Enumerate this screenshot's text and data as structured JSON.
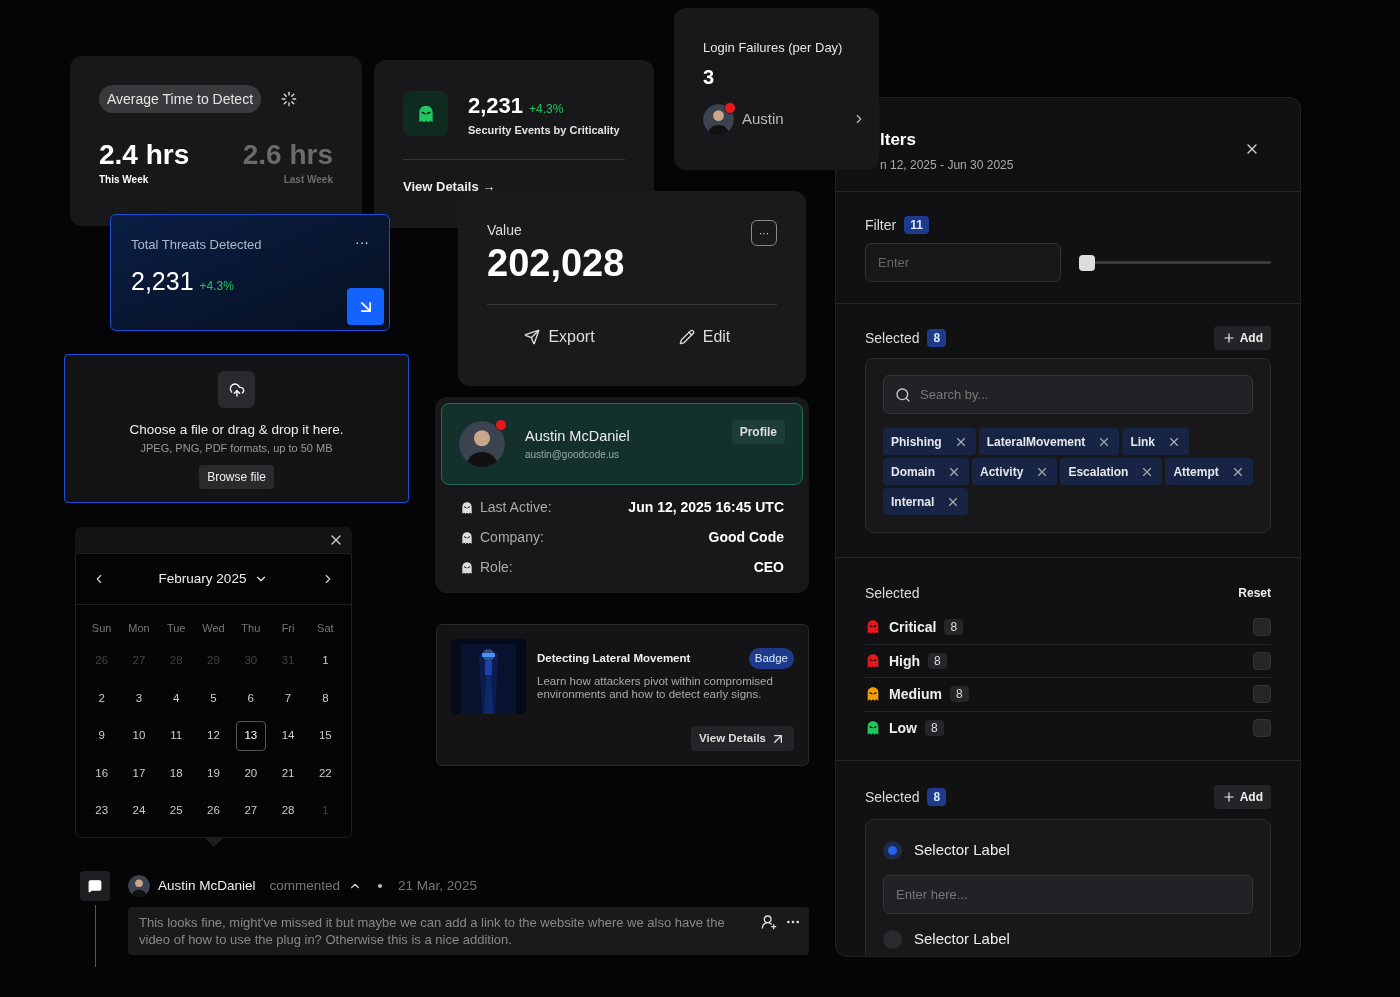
{
  "detect_card": {
    "chip": "Average Time to Detect",
    "stats": [
      {
        "value": "2.4 hrs",
        "label": "This Week",
        "kind": "current"
      },
      {
        "value": "2.6 hrs",
        "label": "Last Week",
        "kind": "previous"
      }
    ]
  },
  "security_card": {
    "value": "2,231",
    "change": "+4.3%",
    "label": "Security Events by Criticality",
    "link": "View Details →"
  },
  "login_card": {
    "title": "Login Failures (per Day)",
    "value": "3",
    "user": "Austin"
  },
  "threats_card": {
    "title": "Total Threats Detected",
    "menu": "···",
    "value": "2,231",
    "change": "+4.3%"
  },
  "value_card": {
    "label": "Value",
    "value": "202,028",
    "menu": "···",
    "actions": [
      {
        "label": "Export",
        "kind": "export"
      },
      {
        "label": "Edit",
        "kind": "edit"
      }
    ]
  },
  "upload": {
    "title": "Choose a file or drag & drop it here.",
    "hint": "JPEG, PNG, PDF formats, up to 50 MB",
    "button": "Browse file"
  },
  "calendar": {
    "month": "February 2025",
    "weekdays": [
      "Sun",
      "Mon",
      "Tue",
      "Wed",
      "Thu",
      "Fri",
      "Sat"
    ],
    "days": [
      {
        "label": "26",
        "outside": true,
        "selected": false
      },
      {
        "label": "27",
        "outside": true,
        "selected": false
      },
      {
        "label": "28",
        "outside": true,
        "selected": false
      },
      {
        "label": "29",
        "outside": true,
        "selected": false
      },
      {
        "label": "30",
        "outside": true,
        "selected": false
      },
      {
        "label": "31",
        "outside": true,
        "selected": false
      },
      {
        "label": "1",
        "outside": false,
        "selected": false
      },
      {
        "label": "2",
        "outside": false,
        "selected": false
      },
      {
        "label": "3",
        "outside": false,
        "selected": false
      },
      {
        "label": "4",
        "outside": false,
        "selected": false
      },
      {
        "label": "5",
        "outside": false,
        "selected": false
      },
      {
        "label": "6",
        "outside": false,
        "selected": false
      },
      {
        "label": "7",
        "outside": false,
        "selected": false
      },
      {
        "label": "8",
        "outside": false,
        "selected": false
      },
      {
        "label": "9",
        "outside": false,
        "selected": false
      },
      {
        "label": "10",
        "outside": false,
        "selected": false
      },
      {
        "label": "11",
        "outside": false,
        "selected": false
      },
      {
        "label": "12",
        "outside": false,
        "selected": false
      },
      {
        "label": "13",
        "outside": false,
        "selected": true
      },
      {
        "label": "14",
        "outside": false,
        "selected": false
      },
      {
        "label": "15",
        "outside": false,
        "selected": false
      },
      {
        "label": "16",
        "outside": false,
        "selected": false
      },
      {
        "label": "17",
        "outside": false,
        "selected": false
      },
      {
        "label": "18",
        "outside": false,
        "selected": false
      },
      {
        "label": "19",
        "outside": false,
        "selected": false
      },
      {
        "label": "20",
        "outside": false,
        "selected": false
      },
      {
        "label": "21",
        "outside": false,
        "selected": false
      },
      {
        "label": "22",
        "outside": false,
        "selected": false
      },
      {
        "label": "23",
        "outside": false,
        "selected": false
      },
      {
        "label": "24",
        "outside": false,
        "selected": false
      },
      {
        "label": "25",
        "outside": false,
        "selected": false
      },
      {
        "label": "26",
        "outside": false,
        "selected": false
      },
      {
        "label": "27",
        "outside": false,
        "selected": false
      },
      {
        "label": "28",
        "outside": false,
        "selected": false
      },
      {
        "label": "1",
        "outside": true,
        "selected": false
      }
    ]
  },
  "profile": {
    "name": "Austin McDaniel",
    "email": "austin@goodcode.us",
    "button": "Profile",
    "details": [
      {
        "label": "Last Active:",
        "value": "Jun 12, 2025 16:45 UTC"
      },
      {
        "label": "Company:",
        "value": "Good Code"
      },
      {
        "label": "Role:",
        "value": "CEO"
      }
    ]
  },
  "course": {
    "kind": "picture",
    "title": "Detecting Lateral Movement",
    "badge": "Badge",
    "description": "Learn how attackers pivot within compromised environments and how to detect early signs.",
    "button": "View Details"
  },
  "comment": {
    "author": "Austin McDaniel",
    "action": "commented",
    "date": "21 Mar, 2025",
    "body": "This looks fine, might've missed it but maybe we can add a link to the website where we also have the video of how to use the plug in? Otherwise this is a nice addition."
  },
  "filters": {
    "title": "lters",
    "range": "n 12, 2025 - Jun 30 2025",
    "filter": {
      "label": "Filter",
      "count": "11",
      "placeholder": "Enter",
      "level": 0
    },
    "tags_section": {
      "label": "Selected",
      "count": "8",
      "add": "Add",
      "search_placeholder": "Search by...",
      "tags": [
        "Phishing",
        "LateralMovement",
        "Link",
        "Domain",
        "Activity",
        "Escalation",
        "Attempt",
        "Internal"
      ]
    },
    "severity": {
      "label": "Selected",
      "reset": "Reset",
      "items": [
        {
          "label": "Critical",
          "count": "8",
          "color": "#e5191c",
          "checked": false
        },
        {
          "label": "High",
          "count": "8",
          "color": "#e5191c",
          "checked": false
        },
        {
          "label": "Medium",
          "count": "8",
          "color": "#f59e0b",
          "checked": false
        },
        {
          "label": "Low",
          "count": "8",
          "color": "#22c55e",
          "checked": false
        }
      ]
    },
    "options": {
      "label": "Selected",
      "count": "8",
      "add": "Add",
      "placeholder": "Enter here...",
      "items": [
        {
          "label": "Selector Label",
          "selected": true
        },
        {
          "label": "Selector Label",
          "selected": false
        }
      ]
    }
  }
}
